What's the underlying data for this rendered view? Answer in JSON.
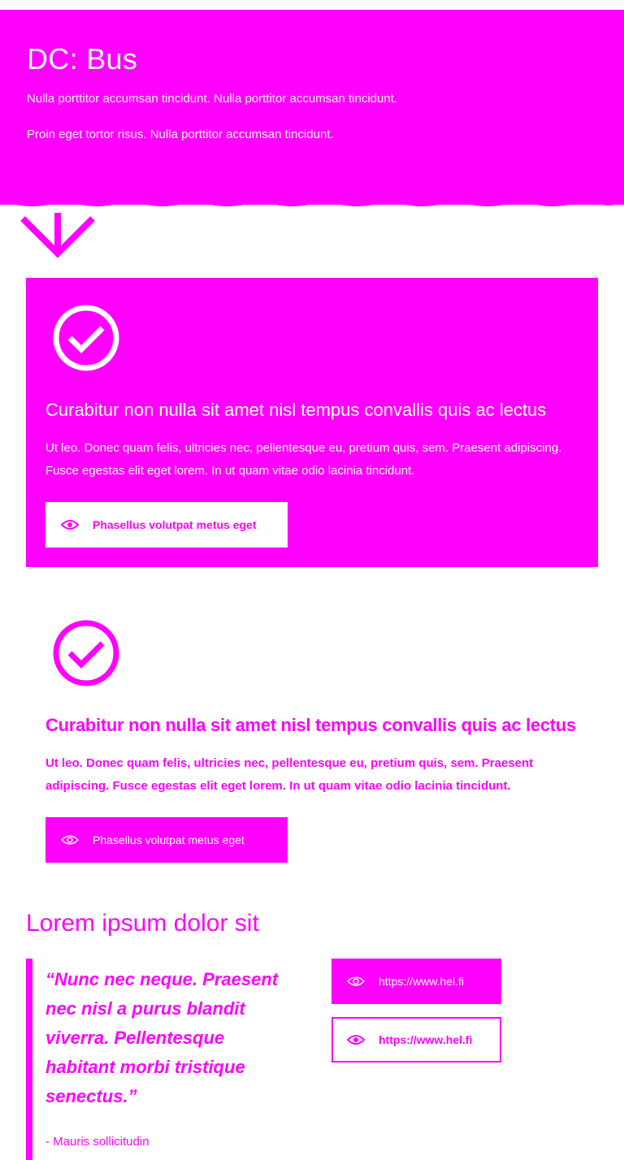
{
  "colors": {
    "brand": "#ff00ff",
    "background": "#ffffff"
  },
  "hero": {
    "title": "DC: Bus",
    "paragraph_1": "Nulla porttitor accumsan tincidunt. Nulla porttitor accumsan tincidunt.",
    "paragraph_2": "Proin eget tortor risus. Nulla porttitor accumsan tincidunt.",
    "arrow_icon": "arrow-down-icon"
  },
  "card_inverted": {
    "icon": "check-circle-icon",
    "heading": "Curabitur non nulla sit amet nisl tempus convallis quis ac lectus",
    "text": "Ut leo. Donec quam felis, ultricies nec, pellentesque eu, pretium quis, sem. Praesent adipiscing. Fusce egestas elit eget lorem. In ut quam vitae odio lacinia tincidunt.",
    "button_label": "Phasellus volutpat metus eget",
    "button_icon": "eye-icon"
  },
  "card_plain": {
    "icon": "check-circle-icon",
    "heading": "Curabitur non nulla sit amet nisl tempus convallis quis ac lectus",
    "text": "Ut leo. Donec quam felis, ultricies nec, pellentesque eu, pretium quis, sem. Praesent adipiscing. Fusce egestas elit eget lorem. In ut quam vitae odio lacinia tincidunt.",
    "button_label": "Phasellus volutpat metus eget",
    "button_icon": "eye-icon"
  },
  "quote_section": {
    "title": "Lorem ipsum dolor sit",
    "quote": "“Nunc nec neque. Praesent nec nisl a purus blandit viverra. Pellentesque habitant morbi tristique senectus.”",
    "author": "- Mauris sollicitudin",
    "links": [
      {
        "label": "https://www.hel.fi",
        "icon": "eye-icon",
        "style": "filled"
      },
      {
        "label": "https://www.hel.fi",
        "icon": "eye-icon",
        "style": "outline"
      }
    ]
  }
}
